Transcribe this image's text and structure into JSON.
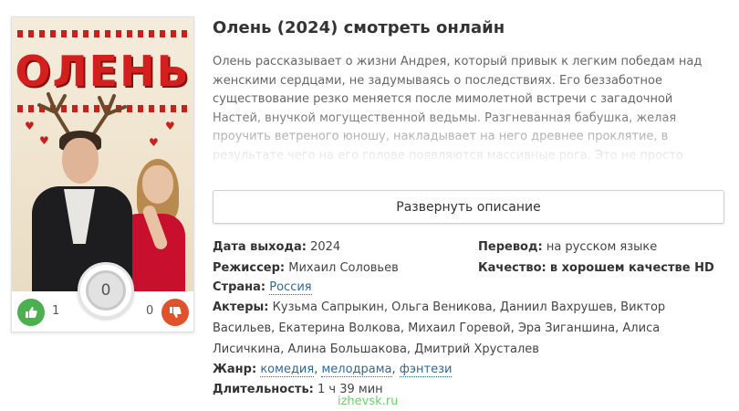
{
  "movie": {
    "title": "Олень (2024) смотреть онлайн",
    "poster_title": "ОЛЕНЬ",
    "description": "Олень рассказывает о жизни Андрея, который привык к легким победам над женскими сердцами, не задумываясь о последствиях. Его беззаботное существование резко меняется после мимолетной встречи с загадочной Настей, внучкой могущественной ведьмы. Разгневанная бабушка, желая проучить ветреного юношу, накладывает на него древнее проклятие, в результате чего на его голове появляются массивные рога. Это не просто физическое изменение, а символ его внутренней пустоты и эгоизма, который теперь виден всем окружающим.",
    "expand_label": "Развернуть описание"
  },
  "rating": {
    "score": "0",
    "likes": "1",
    "dislikes": "0"
  },
  "info": {
    "release_label": "Дата выхода:",
    "release_value": "2024",
    "translation_label": "Перевод:",
    "translation_value": "на русском языке",
    "director_label": "Режиссер:",
    "director_value": "Михаил Соловьев",
    "quality_label": "Качество:",
    "quality_value": "в хорошем качестве HD",
    "country_label": "Страна:",
    "country_value": "Россия",
    "actors_label": "Актеры:",
    "actors_value": "Кузьма Сапрыкин, Ольга Веникова, Даниил Вахрушев, Виктор Васильев, Екатерина Волкова, Михаил Горевой, Эра Зиганшина, Алиса Лисичкина, Алина Большакова, Дмитрий Хрусталев",
    "genre_label": "Жанр:",
    "genres": [
      "комедия",
      "мелодрама",
      "фэнтези"
    ],
    "duration_label": "Длительность:",
    "duration_value": "1 ч 39 мин"
  },
  "watermark": "izhevsk.ru",
  "colors": {
    "like": "#4caf50",
    "dislike": "#e0522b",
    "link": "#2a6a9e",
    "poster_red": "#d41f1f"
  },
  "icons": {
    "like": "thumbs-up-icon",
    "dislike": "thumbs-down-icon"
  }
}
